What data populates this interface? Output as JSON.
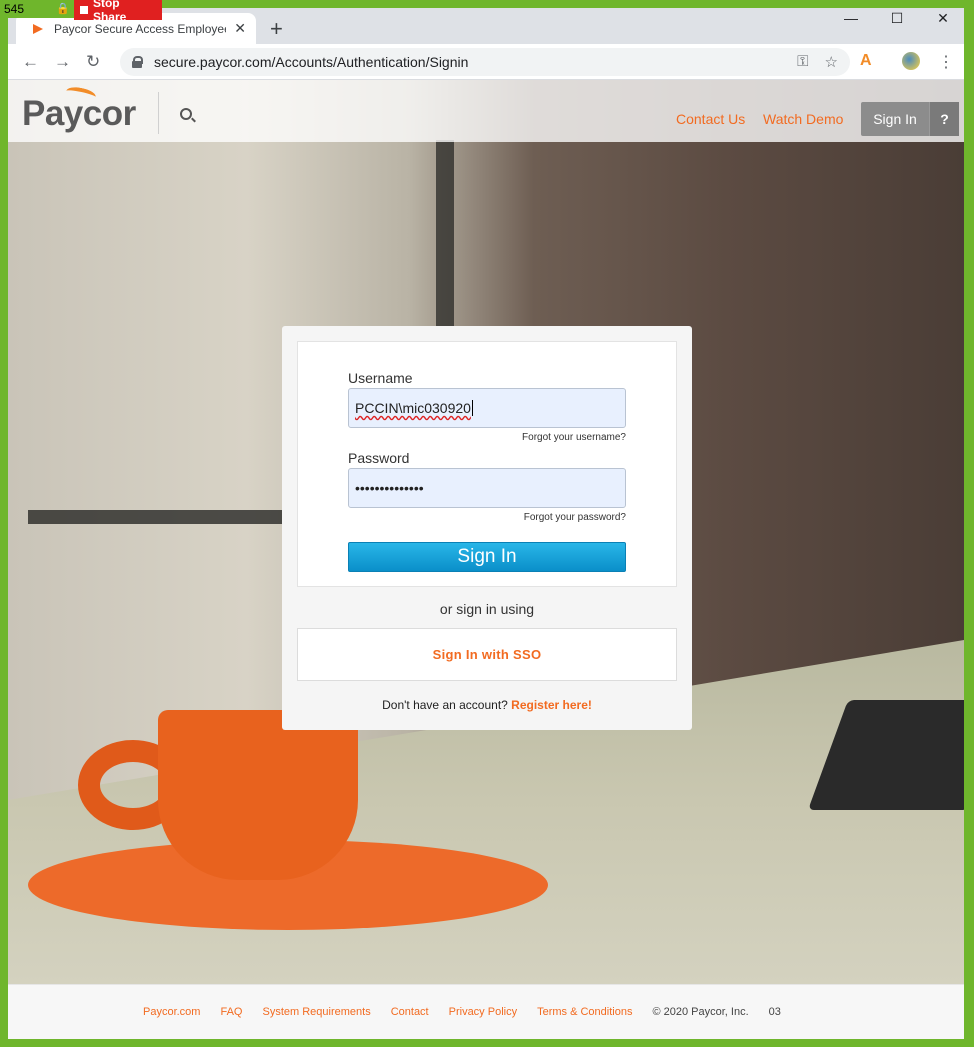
{
  "share": {
    "left_text": "545",
    "stop_label": "Stop Share"
  },
  "browser": {
    "tab_title": "Paycor Secure Access Employee",
    "tab_close": "✕",
    "new_tab": "+",
    "window": {
      "minimize": "—",
      "maximize": "☐",
      "close": "✕"
    },
    "nav": {
      "back": "←",
      "forward": "→",
      "reload": "↻"
    },
    "url": "secure.paycor.com/Accounts/Authentication/Signin",
    "omni_icons": {
      "key": "⚿",
      "star": "☆"
    },
    "menu": "⋮"
  },
  "header": {
    "logo": "Paycor",
    "links": [
      "Contact Us",
      "Watch Demo"
    ],
    "signin": "Sign In",
    "help": "?"
  },
  "login": {
    "username_label": "Username",
    "username_value": "PCCIN\\mic030920",
    "forgot_username": "Forgot your username?",
    "password_label": "Password",
    "password_value": "••••••••••••••",
    "forgot_password": "Forgot your password?",
    "signin_button": "Sign In",
    "or_text": "or sign in using",
    "sso_button": "Sign In with SSO",
    "register_prompt": "Don't have an account?",
    "register_link": "Register here!"
  },
  "footer": {
    "links": [
      "Paycor.com",
      "FAQ",
      "System Requirements",
      "Contact",
      "Privacy Policy",
      "Terms & Conditions"
    ],
    "copyright": "© 2020 Paycor, Inc.",
    "code": "03"
  },
  "colors": {
    "accent": "#f26b21",
    "primary_button": "#0a8fc9",
    "share_frame": "#6fb62c",
    "stop_share": "#e02020"
  }
}
